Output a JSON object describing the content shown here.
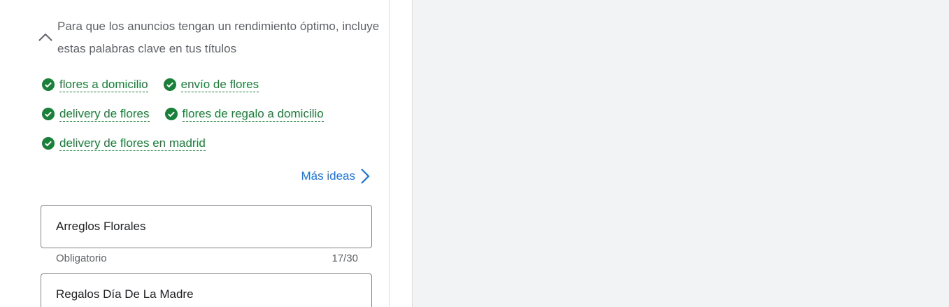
{
  "keyword_tip": {
    "text": "Para que los anuncios tengan un rendimiento óptimo, incluye estas palabras clave en tus títulos"
  },
  "keywords": [
    {
      "label": "flores a domicilio",
      "included": true
    },
    {
      "label": "envío de flores",
      "included": true
    },
    {
      "label": "delivery de flores",
      "included": true
    },
    {
      "label": "flores de regalo a domicilio",
      "included": true
    },
    {
      "label": "delivery de flores en madrid",
      "included": true
    }
  ],
  "more_ideas": {
    "label": "Más ideas"
  },
  "headlines": [
    {
      "value": "Arreglos Florales",
      "helper": "Obligatorio",
      "counter": "17/30"
    },
    {
      "value": "Regalos Día De La Madre"
    }
  ],
  "colors": {
    "keyword_green": "#188038",
    "link_blue": "#1a73e8",
    "muted_text": "#5f6368"
  }
}
